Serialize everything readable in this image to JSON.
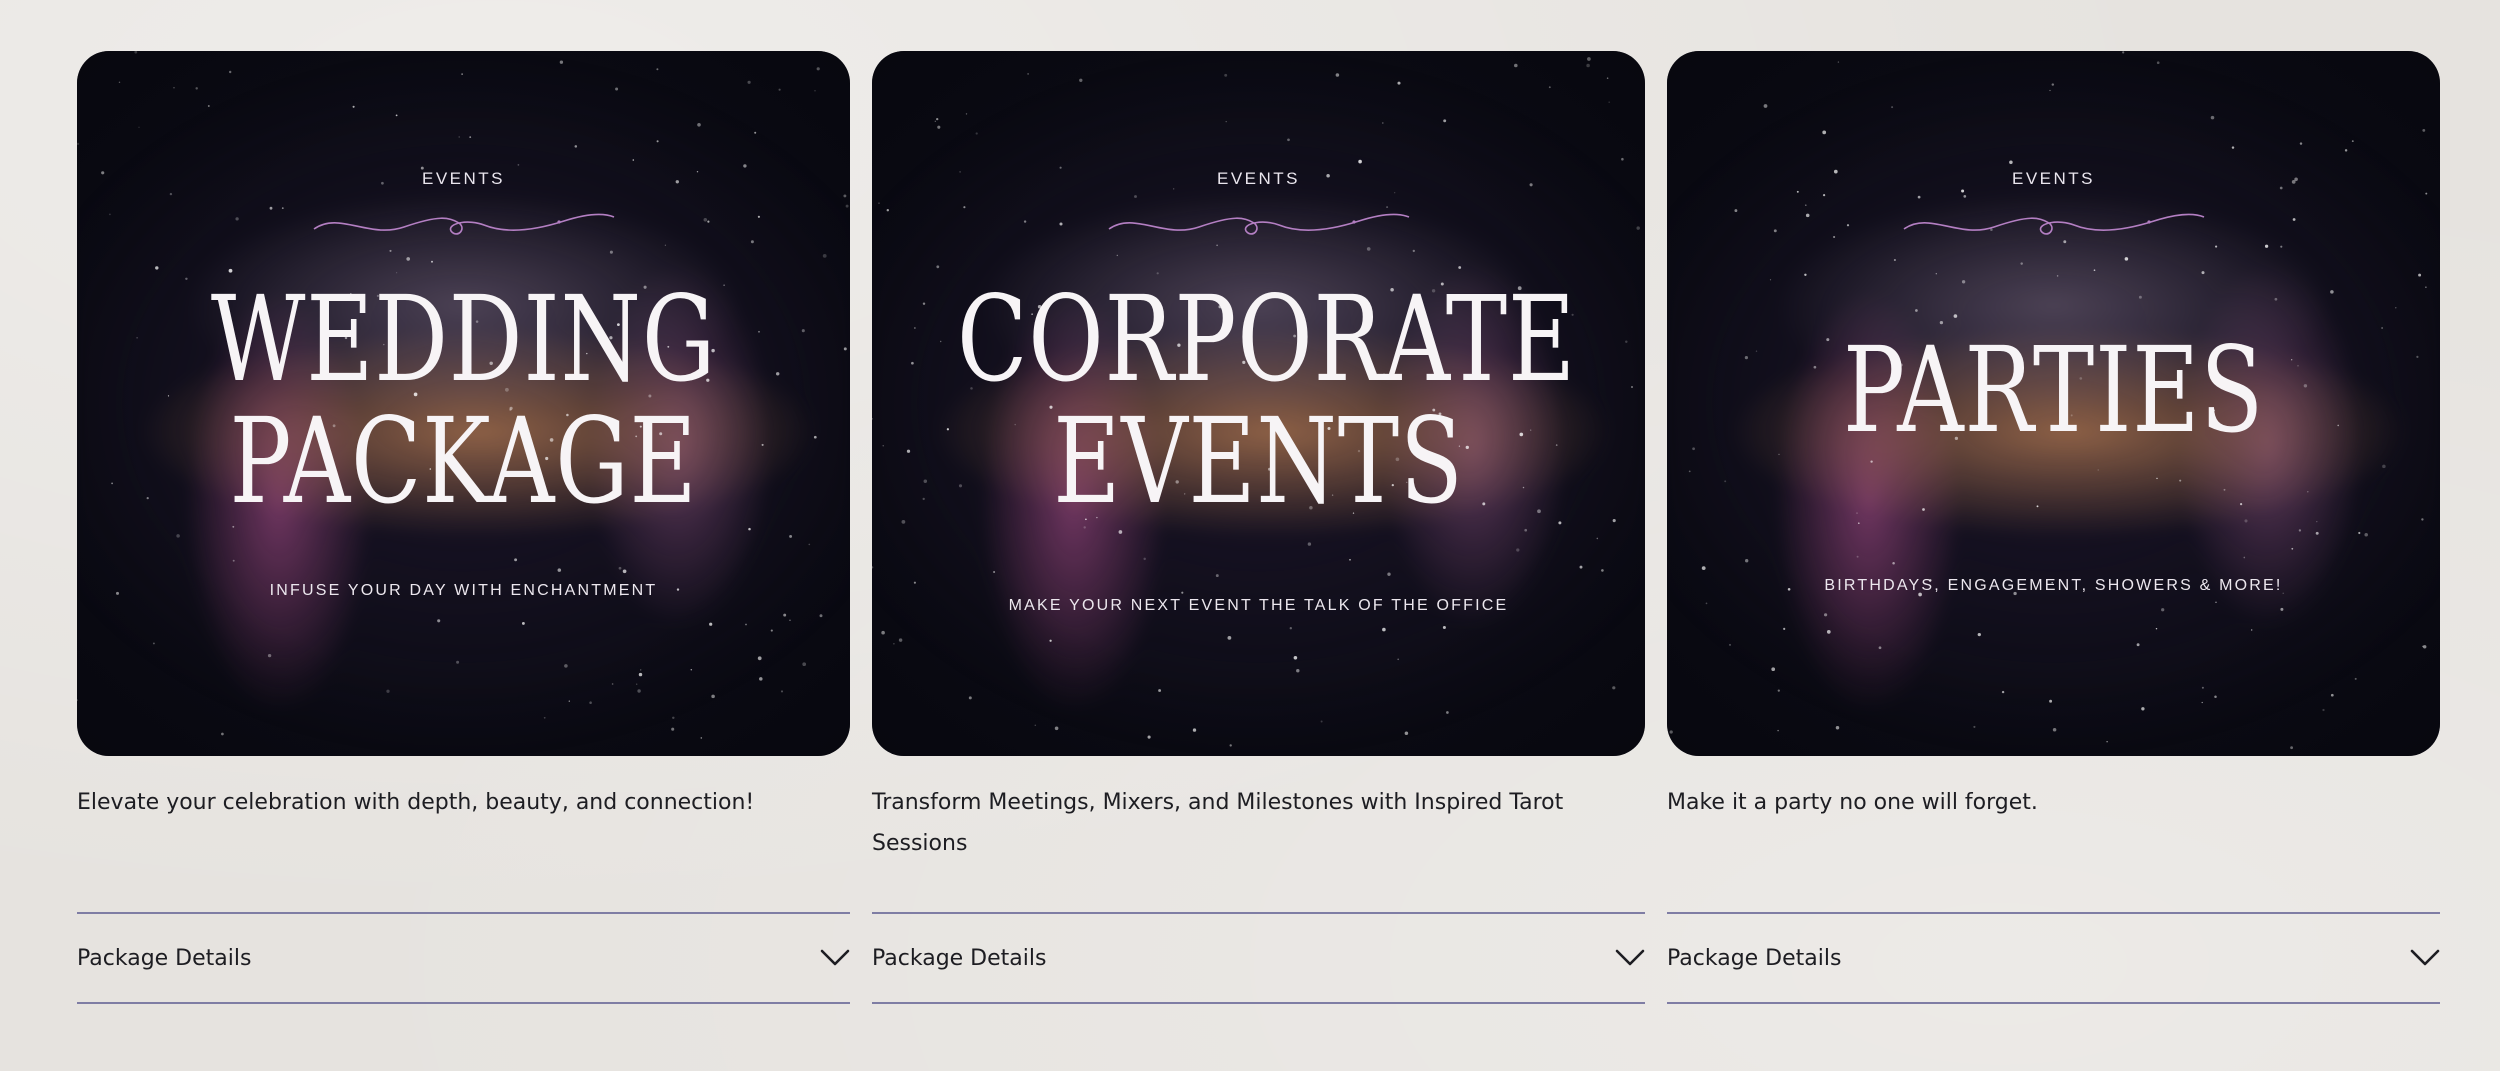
{
  "cards": [
    {
      "kicker": "EVENTS",
      "headline": [
        "WEDDING",
        "PACKAGE"
      ],
      "subline": "INFUSE YOUR DAY WITH ENCHANTMENT",
      "description": "Elevate your celebration with depth, beauty, and connection!",
      "details_label": "Package Details",
      "chevron_icon": "chevron-down-icon"
    },
    {
      "kicker": "EVENTS",
      "headline": [
        "CORPORATE",
        "EVENTS"
      ],
      "subline": "MAKE YOUR NEXT EVENT THE TALK OF THE OFFICE",
      "description": "Transform Meetings, Mixers, and Milestones with Inspired Tarot Sessions",
      "details_label": "Package Details",
      "chevron_icon": "chevron-down-icon"
    },
    {
      "kicker": "EVENTS",
      "headline": [
        "PARTIES"
      ],
      "subline": "BIRTHDAYS, ENGAGEMENT, SHOWERS & MORE!",
      "description": "Make it a party no one will forget.",
      "details_label": "Package Details",
      "chevron_icon": "chevron-down-icon"
    }
  ],
  "colors": {
    "page_background": "#e6e3df",
    "card_background": "#0b0b14",
    "divider": "#7f7da4",
    "flourish": "#b47fc3",
    "text": "#1d1d22"
  }
}
